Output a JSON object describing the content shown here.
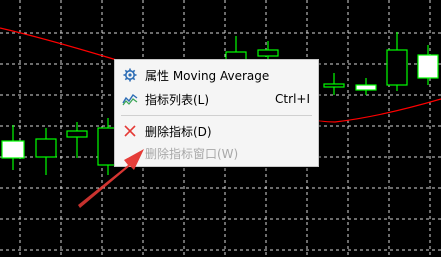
{
  "chart": {
    "background": "#000000",
    "grid_color": "#d9d9d9",
    "up_color": "#00ff00",
    "down_color": "#ffffff",
    "ma_color": "#ff0000"
  },
  "context_menu": {
    "items": [
      {
        "icon": "gear-icon",
        "label": "属性 Moving Average",
        "shortcut": "",
        "enabled": true
      },
      {
        "icon": "indicator-list-icon",
        "label": "指标列表(L)",
        "shortcut": "Ctrl+I",
        "enabled": true
      },
      {
        "icon": "delete-x-icon",
        "label": "删除指标(D)",
        "shortcut": "",
        "enabled": true
      },
      {
        "icon": "",
        "label": "删除指标窗口(W)",
        "shortcut": "",
        "enabled": false
      }
    ]
  },
  "annotation": {
    "arrow_color": "#e53935"
  }
}
